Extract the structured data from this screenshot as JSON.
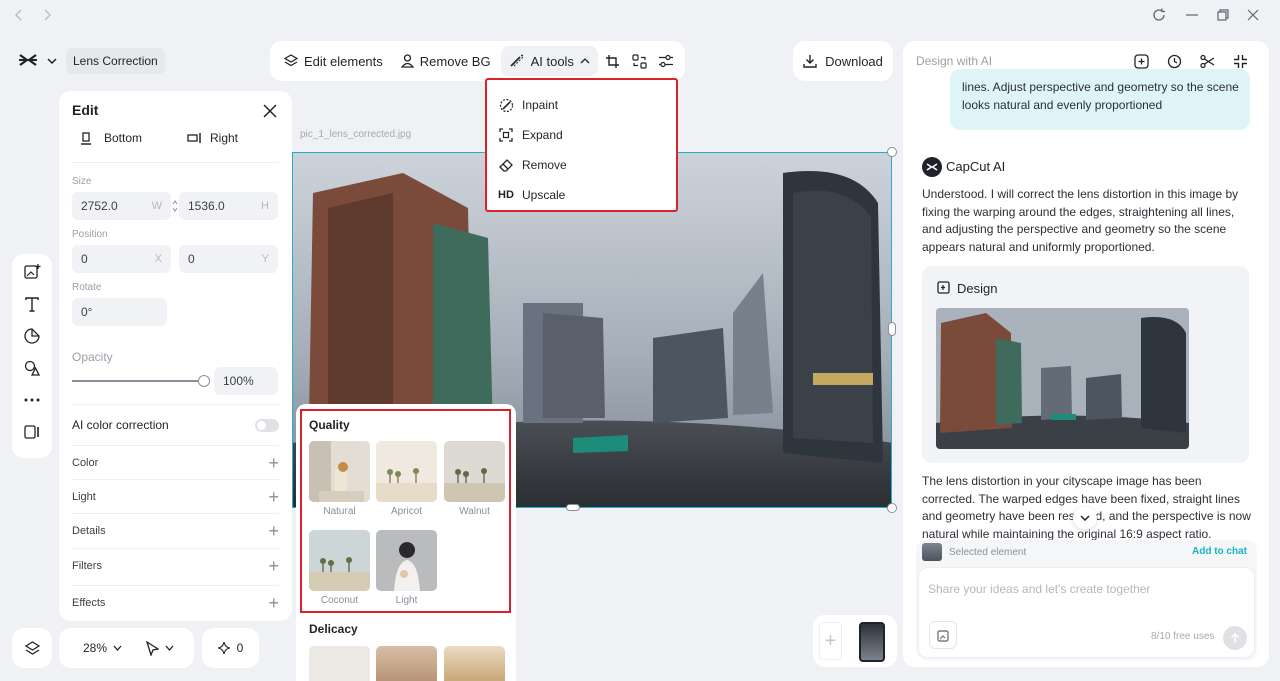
{
  "project": {
    "title": "Lens Correction"
  },
  "toolbar": {
    "edit_elements": "Edit elements",
    "remove_bg": "Remove BG",
    "ai_tools": "AI tools"
  },
  "download": {
    "label": "Download"
  },
  "ai_menu": {
    "items": [
      {
        "label": "Inpaint",
        "icon": "brush-icon"
      },
      {
        "label": "Expand",
        "icon": "expand-icon"
      },
      {
        "label": "Remove",
        "icon": "eraser-icon"
      },
      {
        "label": "Upscale",
        "icon": "hd-icon",
        "badge": "HD"
      }
    ]
  },
  "canvas": {
    "filename": "pic_1_lens_corrected.jpg"
  },
  "edit_panel": {
    "title": "Edit",
    "align_bottom": "Bottom",
    "align_right": "Right",
    "size_label": "Size",
    "width": "2752.0",
    "width_suffix": "W",
    "height": "1536.0",
    "height_suffix": "H",
    "position_label": "Position",
    "pos_x": "0",
    "pos_x_suffix": "X",
    "pos_y": "0",
    "pos_y_suffix": "Y",
    "rotate_label": "Rotate",
    "rotate": "0°",
    "opacity_label": "Opacity",
    "opacity_value": "100%",
    "opacity_fraction": 1.0,
    "ai_color_correction": "AI color correction",
    "sections": [
      "Color",
      "Light",
      "Details",
      "Filters",
      "Effects"
    ]
  },
  "filters": {
    "quality_heading": "Quality",
    "quality_items": [
      "Natural",
      "Apricot",
      "Walnut",
      "Coconut",
      "Light"
    ],
    "delicacy_heading": "Delicacy"
  },
  "bottom_bar": {
    "zoom": "28%",
    "sparkle_count": "0"
  },
  "chat": {
    "header_title": "Design with AI",
    "user_message_tail": "lines. Adjust perspective and geometry so the scene looks natural and evenly proportioned",
    "bot_name": "CapCut AI",
    "bot_reply": "Understood. I will correct the lens distortion in this image by fixing the warping around the edges, straightening all lines, and adjusting the perspective and geometry so the scene appears natural and uniformly proportioned.",
    "design_card_title": "Design",
    "result_text": "The lens distortion in your cityscape image has been corrected. The warped edges have been fixed, straight lines and geometry have been restored, and the perspective is now natural while maintaining the original 16:9 aspect ratio.",
    "selected_element": "Selected element",
    "add_to_chat": "Add to chat",
    "input_placeholder": "Share your ideas and let's create together",
    "free_uses": "8/10 free uses"
  },
  "colors": {
    "accent": "#1fb3c9",
    "highlight_border": "#d9222a",
    "link": "#19b3c4"
  }
}
